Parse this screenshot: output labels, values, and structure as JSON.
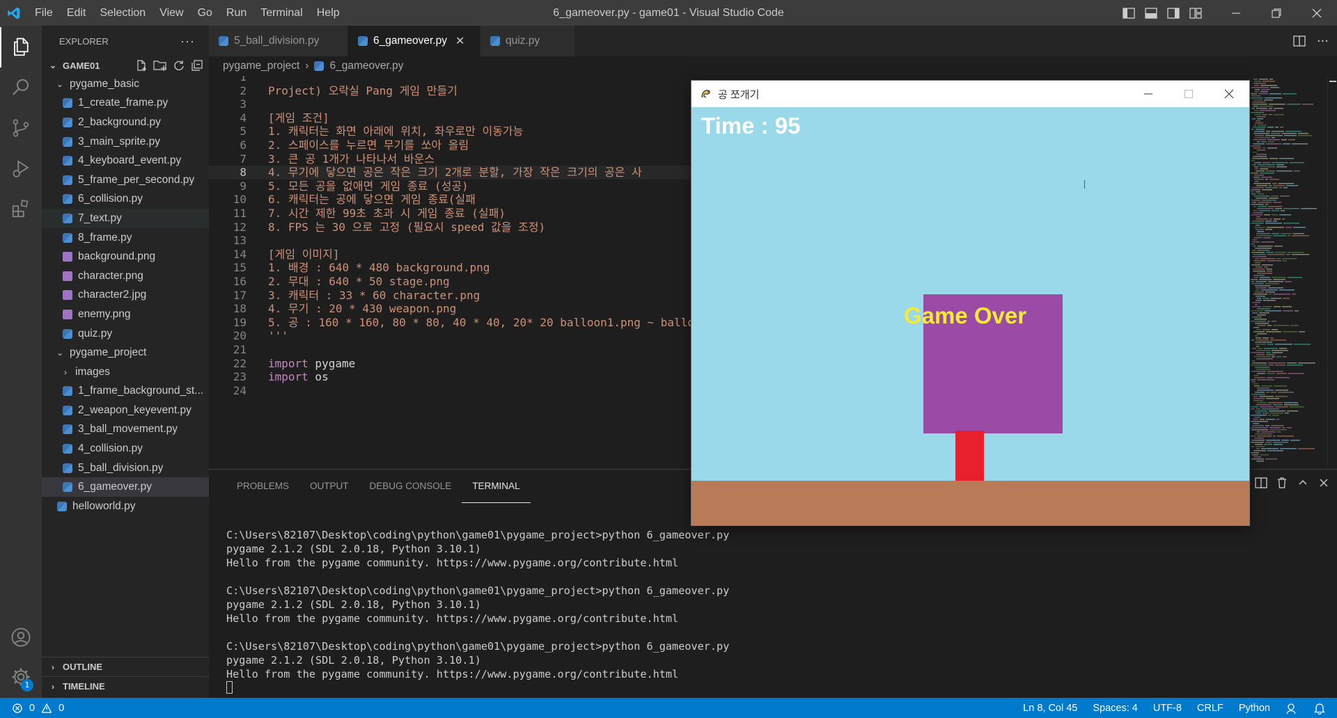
{
  "window": {
    "title": "6_gameover.py - game01 - Visual Studio Code",
    "menu": [
      "File",
      "Edit",
      "Selection",
      "View",
      "Go",
      "Run",
      "Terminal",
      "Help"
    ]
  },
  "sidebar": {
    "title": "EXPLORER",
    "more": "···",
    "root": "GAME01",
    "tree": [
      {
        "label": "pygame_basic",
        "kind": "folder-open",
        "depth": 1
      },
      {
        "label": "1_create_frame.py",
        "kind": "py",
        "depth": 2
      },
      {
        "label": "2_background.py",
        "kind": "py",
        "depth": 2
      },
      {
        "label": "3_main_sprite.py",
        "kind": "py",
        "depth": 2
      },
      {
        "label": "4_keyboard_event.py",
        "kind": "py",
        "depth": 2
      },
      {
        "label": "5_frame_per_second.py",
        "kind": "py",
        "depth": 2
      },
      {
        "label": "6_collision.py",
        "kind": "py",
        "depth": 2
      },
      {
        "label": "7_text.py",
        "kind": "py",
        "depth": 2,
        "state": "hover"
      },
      {
        "label": "8_frame.py",
        "kind": "py",
        "depth": 2
      },
      {
        "label": "background.png",
        "kind": "png",
        "depth": 2
      },
      {
        "label": "character.png",
        "kind": "png",
        "depth": 2
      },
      {
        "label": "character2.jpg",
        "kind": "png",
        "depth": 2
      },
      {
        "label": "enemy.png",
        "kind": "png",
        "depth": 2
      },
      {
        "label": "quiz.py",
        "kind": "py",
        "depth": 2
      },
      {
        "label": "pygame_project",
        "kind": "folder-open",
        "depth": 1
      },
      {
        "label": "images",
        "kind": "folder-closed",
        "depth": 2
      },
      {
        "label": "1_frame_background_st...",
        "kind": "py",
        "depth": 2
      },
      {
        "label": "2_weapon_keyevent.py",
        "kind": "py",
        "depth": 2
      },
      {
        "label": "3_ball_movement.py",
        "kind": "py",
        "depth": 2
      },
      {
        "label": "4_collision.py",
        "kind": "py",
        "depth": 2
      },
      {
        "label": "5_ball_division.py",
        "kind": "py",
        "depth": 2
      },
      {
        "label": "6_gameover.py",
        "kind": "py",
        "depth": 2,
        "state": "selected"
      },
      {
        "label": "helloworld.py",
        "kind": "py",
        "depth": 1
      }
    ],
    "outline": "OUTLINE",
    "timeline": "TIMELINE"
  },
  "tabs": [
    {
      "label": "5_ball_division.py",
      "active": false
    },
    {
      "label": "6_gameover.py",
      "active": true
    },
    {
      "label": "quiz.py",
      "active": false
    }
  ],
  "breadcrumb": {
    "folder": "pygame_project",
    "file": "6_gameover.py"
  },
  "editor": {
    "current_line": 8,
    "lines": [
      {
        "n": "1",
        "t": "'''",
        "c": "str"
      },
      {
        "n": "2",
        "t": "Project) 오락실 Pang 게임 만들기",
        "c": "str"
      },
      {
        "n": "3",
        "t": "",
        "c": "str"
      },
      {
        "n": "4",
        "t": "[게임 조건]",
        "c": "str"
      },
      {
        "n": "5",
        "t": "1. 캐릭터는 화면 아래에 위치, 좌우로만 이동가능",
        "c": "str"
      },
      {
        "n": "6",
        "t": "2. 스페이스를 누르면 무기를 쏘아 올림",
        "c": "str"
      },
      {
        "n": "7",
        "t": "3. 큰 공 1개가 나타나서 바운스",
        "c": "str"
      },
      {
        "n": "8",
        "t": "4. 무기에 닿으면 공은 작은 크기 2개로 분할, 가장 작은 크기의 공은 사",
        "c": "str"
      },
      {
        "n": "9",
        "t": "5. 모든 공을 없애면 게임 종료 (성공)",
        "c": "str"
      },
      {
        "n": "10",
        "t": "6. 캐릭터는 공에 닿으면 게임 종료(실패",
        "c": "str"
      },
      {
        "n": "11",
        "t": "7. 시간 제한 99초 초과 시 게임 종료 (실패)",
        "c": "str"
      },
      {
        "n": "12",
        "t": "8. FPS 는 30 으로 고정 (필요시 speed 값을 조정)",
        "c": "str"
      },
      {
        "n": "13",
        "t": "",
        "c": "str"
      },
      {
        "n": "14",
        "t": "[게임 이미지]",
        "c": "str"
      },
      {
        "n": "15",
        "t": "1. 배경 : 640 * 480 background.png",
        "c": "str"
      },
      {
        "n": "16",
        "t": "2. 무대 : 640 * 50 stage.png",
        "c": "str"
      },
      {
        "n": "17",
        "t": "3. 캐릭터 : 33 * 60 character.png",
        "c": "str"
      },
      {
        "n": "18",
        "t": "4. 무기 : 20 * 430 weapon.png",
        "c": "str"
      },
      {
        "n": "19",
        "t": "5. 공 : 160 * 160, 80 * 80, 40 * 40, 20* 20 balloon1.png ~ ballo",
        "c": "str"
      },
      {
        "n": "20",
        "t": "'''",
        "c": "str"
      },
      {
        "n": "21",
        "t": "",
        "c": "plain"
      },
      {
        "n": "22",
        "kw": "import",
        "rest": " pygame"
      },
      {
        "n": "23",
        "kw": "import",
        "rest": " os"
      },
      {
        "n": "24",
        "t": "",
        "c": "plain"
      }
    ]
  },
  "panel": {
    "tabs": [
      "PROBLEMS",
      "OUTPUT",
      "DEBUG CONSOLE",
      "TERMINAL"
    ],
    "active_tab": "TERMINAL",
    "terminal": [
      "C:\\Users\\82107\\Desktop\\coding\\python\\game01\\pygame_project>python 6_gameover.py",
      "pygame 2.1.2 (SDL 2.0.18, Python 3.10.1)",
      "Hello from the pygame community. https://www.pygame.org/contribute.html",
      "",
      "C:\\Users\\82107\\Desktop\\coding\\python\\game01\\pygame_project>python 6_gameover.py",
      "pygame 2.1.2 (SDL 2.0.18, Python 3.10.1)",
      "Hello from the pygame community. https://www.pygame.org/contribute.html",
      "",
      "C:\\Users\\82107\\Desktop\\coding\\python\\game01\\pygame_project>python 6_gameover.py",
      "pygame 2.1.2 (SDL 2.0.18, Python 3.10.1)",
      "Hello from the pygame community. https://www.pygame.org/contribute.html"
    ]
  },
  "statusbar": {
    "errors": "0",
    "warnings": "0",
    "position": "Ln 8, Col 45",
    "spaces": "Spaces: 4",
    "encoding": "UTF-8",
    "eol": "CRLF",
    "language": "Python"
  },
  "activity": {
    "settings_badge": "1"
  },
  "game_window": {
    "title": "공 쪼개기",
    "time_label": "Time : 95",
    "game_over": "Game Over",
    "colors": {
      "sky": "#9ad9e9",
      "stage": "#b87a57",
      "box": "#9b4aa6",
      "weapon": "#e8202b",
      "game_over_text": "#f5e93a"
    }
  },
  "colors": {
    "accent": "#007acc",
    "string": "#ce9178",
    "keyword": "#c586c0"
  }
}
